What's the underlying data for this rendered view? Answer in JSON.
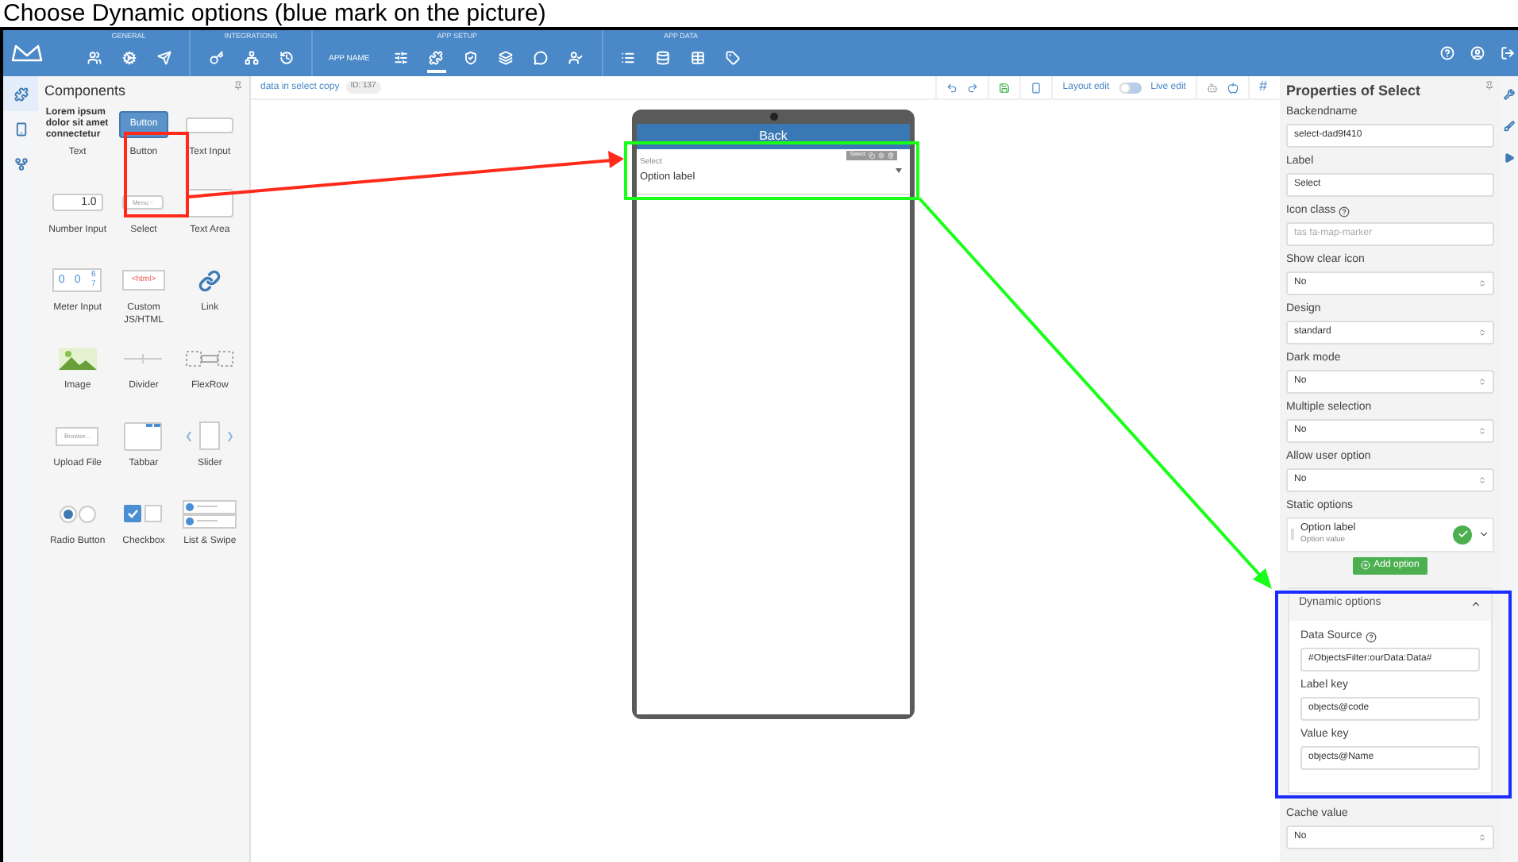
{
  "caption": "Choose Dynamic options (blue mark on the picture)",
  "topbar": {
    "sections": [
      {
        "label": "GENERAL",
        "items": [
          {
            "selected": false
          },
          {
            "selected": false
          },
          {
            "selected": false
          }
        ]
      },
      {
        "label": "INTEGRATIONS",
        "items": [
          {
            "selected": false
          },
          {
            "selected": false
          },
          {
            "selected": false
          }
        ]
      },
      {
        "label": "APP SETUP",
        "app_name": "APP NAME",
        "items": [
          {
            "selected": false
          },
          {
            "selected": true
          },
          {
            "selected": false
          },
          {
            "selected": false
          },
          {
            "selected": false
          },
          {
            "selected": false
          }
        ]
      },
      {
        "label": "APP DATA",
        "items": [
          {
            "selected": false
          },
          {
            "selected": false
          },
          {
            "selected": false
          },
          {
            "selected": false
          }
        ]
      }
    ]
  },
  "left_rail": [
    {
      "selected": true
    },
    {
      "selected": false
    },
    {
      "selected": false
    }
  ],
  "components": {
    "title": "Components",
    "items": [
      {
        "kind": "text",
        "label": "Text",
        "preview": "Lorem ipsum dolor sit amet connectetur"
      },
      {
        "kind": "button",
        "label": "Button",
        "preview": "Button"
      },
      {
        "kind": "text_input",
        "label": "Text Input"
      },
      {
        "kind": "number_input",
        "label": "Number Input",
        "preview": "1.0"
      },
      {
        "kind": "select",
        "label": "Select",
        "preview": "Menu"
      },
      {
        "kind": "text_area",
        "label": "Text Area"
      },
      {
        "kind": "meter",
        "label": "Meter Input",
        "digits": [
          "0",
          "0",
          "6",
          "7"
        ]
      },
      {
        "kind": "custom",
        "label": "Custom JS/HTML",
        "preview": "<html>"
      },
      {
        "kind": "link",
        "label": "Link"
      },
      {
        "kind": "image",
        "label": "Image"
      },
      {
        "kind": "divider",
        "label": "Divider"
      },
      {
        "kind": "flexrow",
        "label": "FlexRow"
      },
      {
        "kind": "upload",
        "label": "Upload File",
        "preview": "Browse..."
      },
      {
        "kind": "tabbar",
        "label": "Tabbar"
      },
      {
        "kind": "slider",
        "label": "Slider"
      },
      {
        "kind": "radio",
        "label": "Radio Button"
      },
      {
        "kind": "checkbox",
        "label": "Checkbox"
      },
      {
        "kind": "list",
        "label": "List & Swipe"
      }
    ]
  },
  "canvas": {
    "breadcrumb": "data in select copy",
    "id_badge": "ID: 137",
    "layout_edit": "Layout edit",
    "live_edit": "Live edit",
    "live_on": false,
    "hash": "#",
    "phone": {
      "header": "Back",
      "element_toolbar": "Select",
      "select_label": "Select",
      "select_value": "Option label"
    }
  },
  "properties": {
    "title": "Properties of Select",
    "fields": [
      {
        "kind": "input",
        "label": "Backendname",
        "value": "select-dad9f410"
      },
      {
        "kind": "input",
        "label": "Label",
        "value": "Select"
      },
      {
        "kind": "input",
        "label": "Icon class",
        "help": true,
        "placeholder": "fas fa-map-marker"
      },
      {
        "kind": "select",
        "label": "Show clear icon",
        "value": "No"
      },
      {
        "kind": "select",
        "label": "Design",
        "value": "standard"
      },
      {
        "kind": "select",
        "label": "Dark mode",
        "value": "No"
      },
      {
        "kind": "select",
        "label": "Multiple selection",
        "value": "No"
      },
      {
        "kind": "select",
        "label": "Allow user option",
        "value": "No"
      }
    ],
    "static_options": {
      "label": "Static options",
      "options": [
        {
          "label": "Option label",
          "value": "Option value",
          "checked": true
        }
      ],
      "add_button": "Add option"
    },
    "dynamic_options": {
      "title": "Dynamic options",
      "expanded": true,
      "fields": [
        {
          "label": "Data Source",
          "help": true,
          "value": "#ObjectsFilter:ourData:Data#"
        },
        {
          "label": "Label key",
          "value": "objects@code"
        },
        {
          "label": "Value key",
          "value": "objects@Name"
        }
      ]
    },
    "after_fields": [
      {
        "kind": "select",
        "label": "Cache value",
        "value": "No"
      }
    ]
  },
  "annotations": [
    {
      "kind": "box",
      "color": "#ff2a1a"
    },
    {
      "kind": "arrow",
      "color": "#ff2a1a"
    },
    {
      "kind": "box",
      "color": "#19ff19"
    },
    {
      "kind": "arrow",
      "color": "#19ff19"
    },
    {
      "kind": "box",
      "color": "#1a2cff"
    }
  ]
}
